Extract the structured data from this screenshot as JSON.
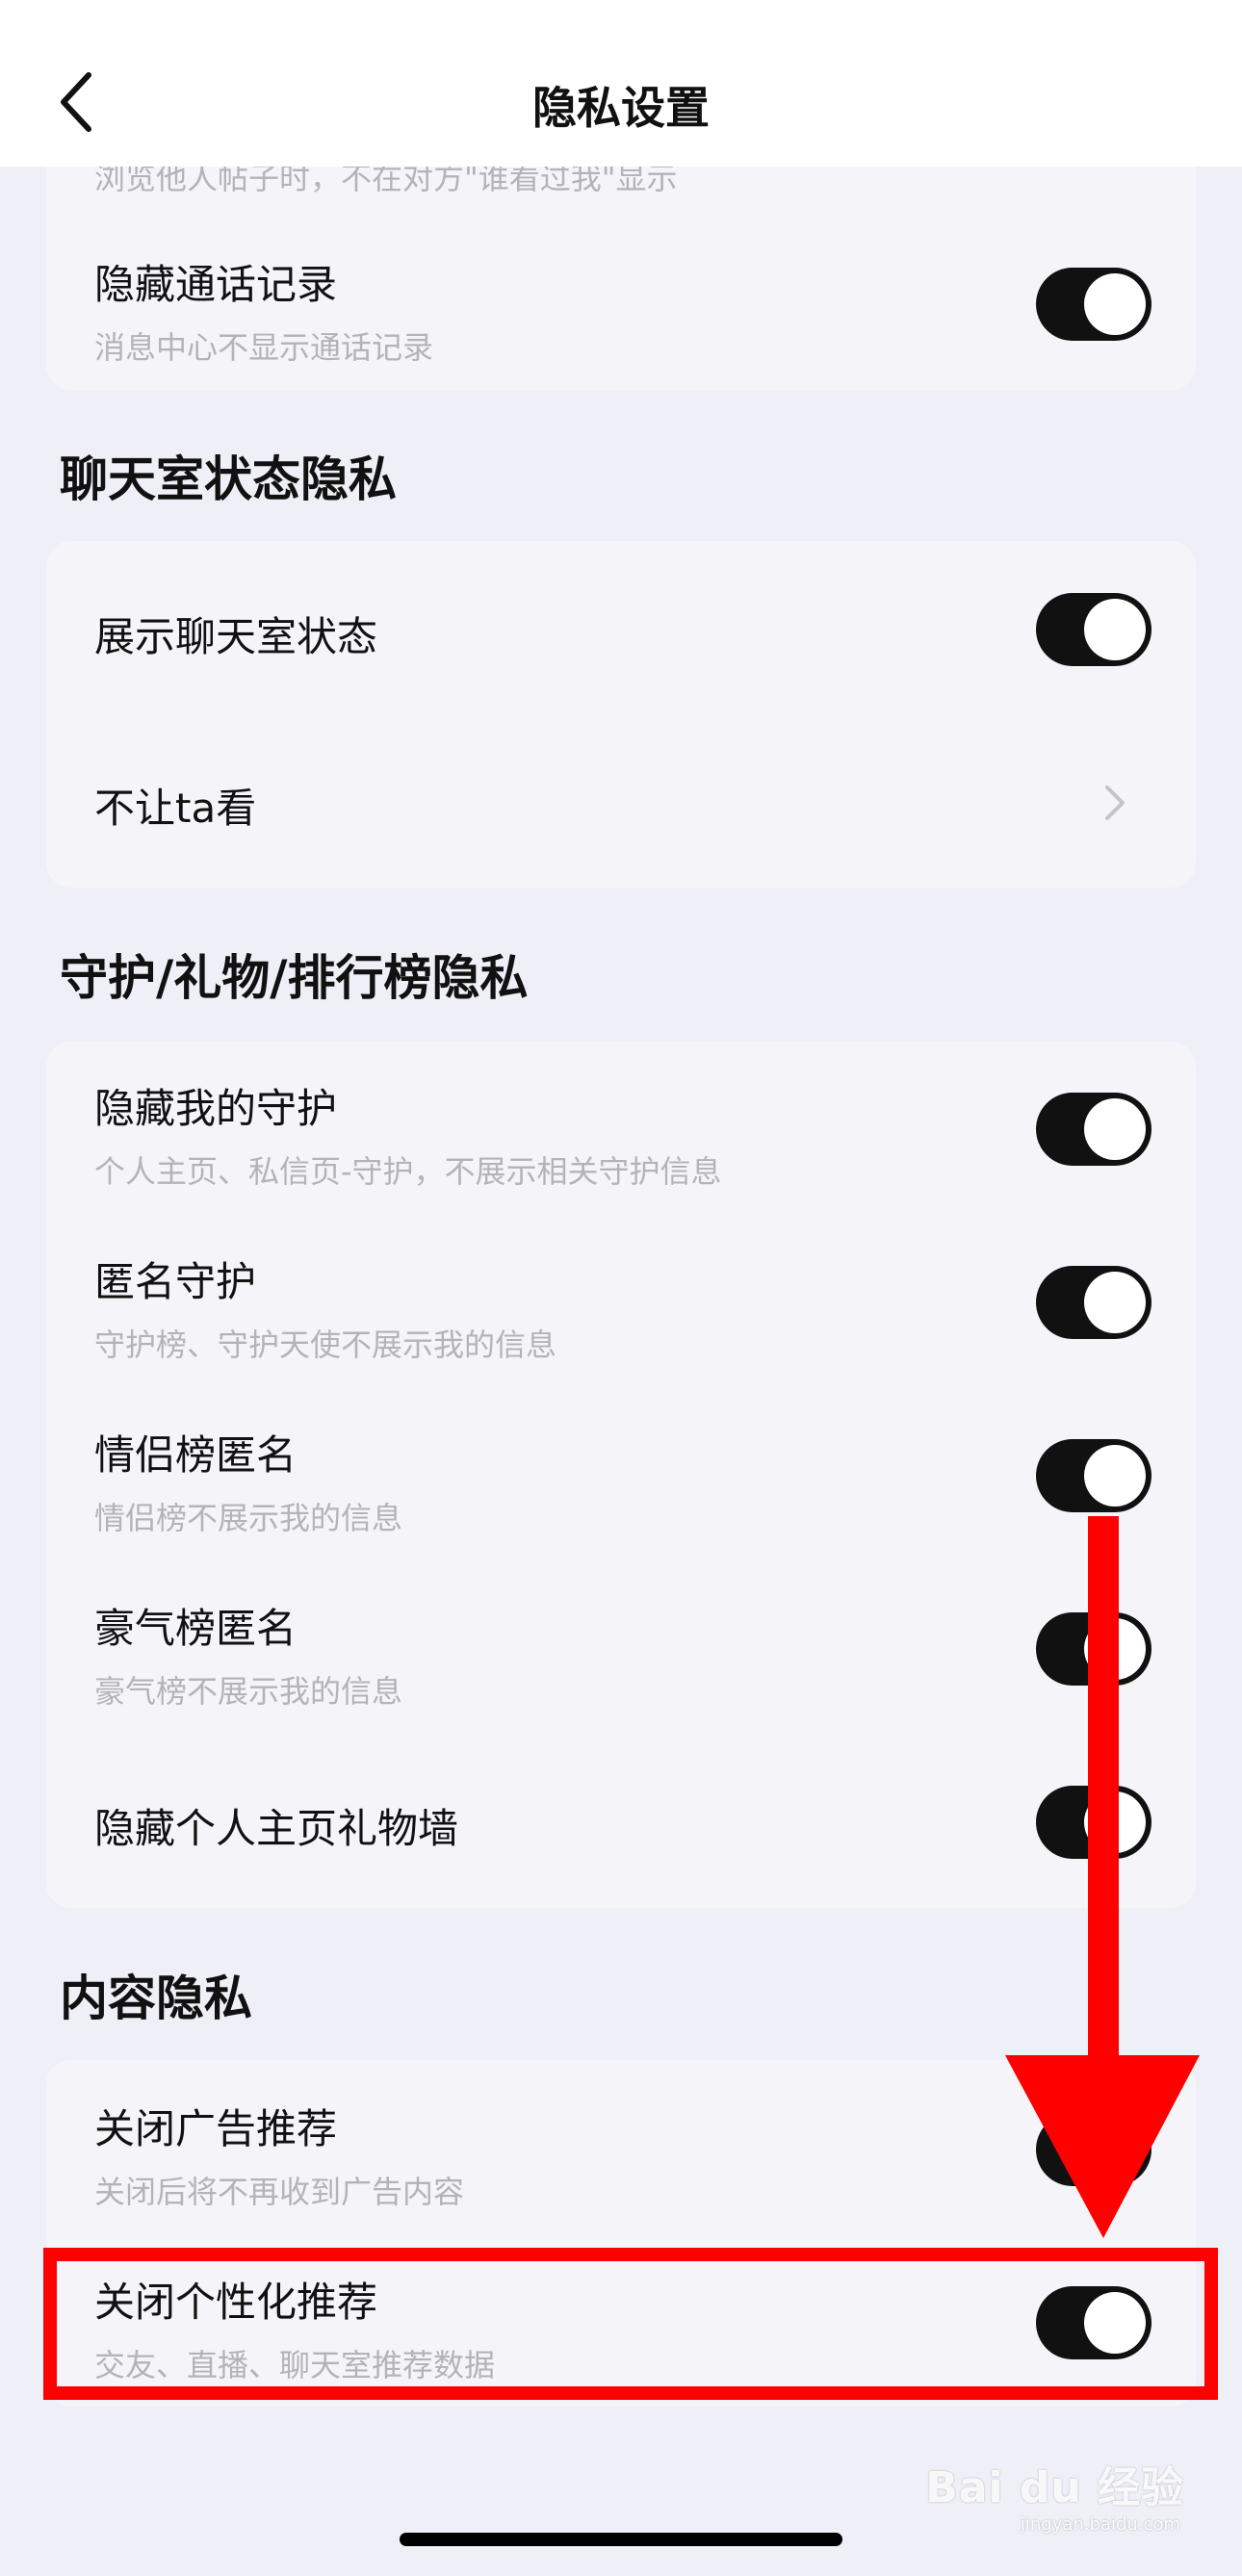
{
  "nav": {
    "title": "隐私设置"
  },
  "card1": {
    "partial_sub": "浏览他人帖子时，不在对方\"谁看过我\"显示",
    "hide_call": {
      "title": "隐藏通话记录",
      "sub": "消息中心不显示通话记录",
      "on": true
    }
  },
  "sections": {
    "chatroom": "聊天室状态隐私",
    "guard": "守护/礼物/排行榜隐私",
    "content": "内容隐私"
  },
  "chatroom": {
    "show_status": {
      "title": "展示聊天室状态",
      "on": true
    },
    "hide_from": {
      "title": "不让ta看"
    }
  },
  "guard": {
    "hide_guard": {
      "title": "隐藏我的守护",
      "sub": "个人主页、私信页-守护，不展示相关守护信息",
      "on": true
    },
    "anon_guard": {
      "title": "匿名守护",
      "sub": "守护榜、守护天使不展示我的信息",
      "on": true
    },
    "couple_anon": {
      "title": "情侣榜匿名",
      "sub": "情侣榜不展示我的信息",
      "on": true
    },
    "rich_anon": {
      "title": "豪气榜匿名",
      "sub": "豪气榜不展示我的信息",
      "on": true
    },
    "hide_gift_wall": {
      "title": "隐藏个人主页礼物墙",
      "on": true
    }
  },
  "content": {
    "close_ads": {
      "title": "关闭广告推荐",
      "sub": "关闭后将不再收到广告内容",
      "on": true
    },
    "close_personal": {
      "title": "关闭个性化推荐",
      "sub": "交友、直播、聊天室推荐数据",
      "on": true
    }
  },
  "watermark": {
    "brand": "Bai du 经验",
    "url": "jingyan.baidu.com"
  },
  "colors": {
    "accent": "#111111",
    "annotation": "#ff0000",
    "background": "#eff0f7",
    "card": "#f5f5f9"
  }
}
